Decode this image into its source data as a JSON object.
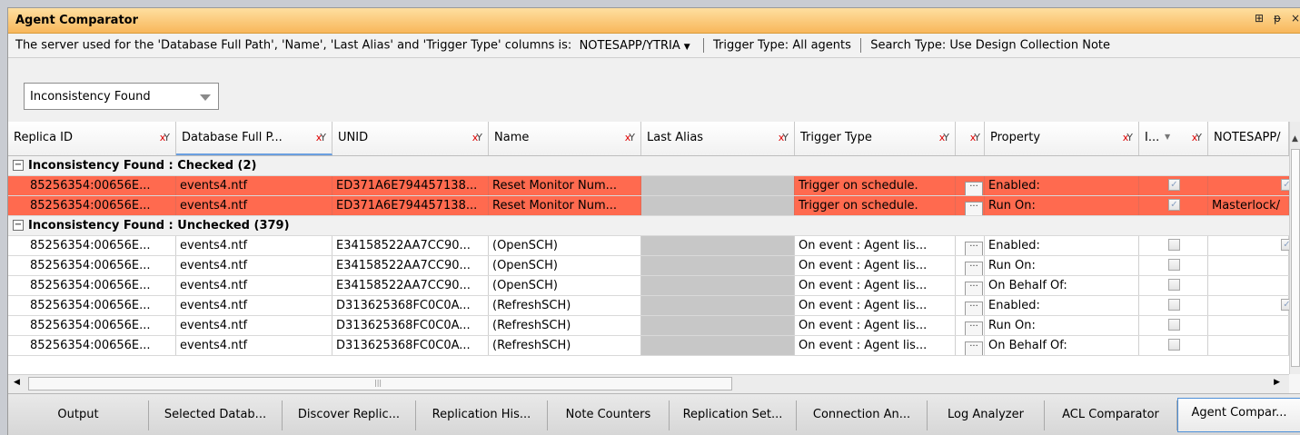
{
  "panel": {
    "title": "Agent Comparator",
    "controls": [
      "⊞",
      "ᵽ",
      "×"
    ]
  },
  "infobar": {
    "prefix": "The server used for the 'Database Full Path', 'Name', 'Last Alias' and 'Trigger Type' columns is:",
    "server": "NOTESAPP/YTRIA",
    "trigger": "Trigger Type:  All agents",
    "search": "Search Type:  Use Design Collection Note"
  },
  "filter": {
    "value": "Inconsistency Found"
  },
  "columns": [
    "Replica ID",
    "Database Full P...",
    "UNID",
    "Name",
    "Last Alias",
    "Trigger Type",
    "",
    "Property",
    "I...",
    "NOTESAPP/"
  ],
  "groups": [
    {
      "label": "Inconsistency Found : Checked (2)",
      "rows": [
        {
          "replica": "85256354:00656E...",
          "db": "events4.ntf",
          "unid": "ED371A6E794457138...",
          "name": "Reset Monitor Num...",
          "trigger": "Trigger on schedule.",
          "property": "Enabled:",
          "i_checked": true,
          "last_checked": true,
          "last_text": ""
        },
        {
          "replica": "85256354:00656E...",
          "db": "events4.ntf",
          "unid": "ED371A6E794457138...",
          "name": "Reset Monitor Num...",
          "trigger": "Trigger on schedule.",
          "property": "Run On:",
          "i_checked": true,
          "last_checked": false,
          "last_text": "Masterlock/"
        }
      ]
    },
    {
      "label": "Inconsistency Found : Unchecked (379)",
      "rows": [
        {
          "replica": "85256354:00656E...",
          "db": "events4.ntf",
          "unid": "E34158522AA7CC90...",
          "name": "(OpenSCH)",
          "trigger": "On event : Agent lis...",
          "property": "Enabled:",
          "i_checked": false,
          "last_checked": true,
          "last_text": ""
        },
        {
          "replica": "85256354:00656E...",
          "db": "events4.ntf",
          "unid": "E34158522AA7CC90...",
          "name": "(OpenSCH)",
          "trigger": "On event : Agent lis...",
          "property": "Run On:",
          "i_checked": false,
          "last_checked": false,
          "last_text": ""
        },
        {
          "replica": "85256354:00656E...",
          "db": "events4.ntf",
          "unid": "E34158522AA7CC90...",
          "name": "(OpenSCH)",
          "trigger": "On event : Agent lis...",
          "property": "On Behalf Of:",
          "i_checked": false,
          "last_checked": false,
          "last_text": ""
        },
        {
          "replica": "85256354:00656E...",
          "db": "events4.ntf",
          "unid": "D313625368FC0C0A...",
          "name": "(RefreshSCH)",
          "trigger": "On event : Agent lis...",
          "property": "Enabled:",
          "i_checked": false,
          "last_checked": true,
          "last_text": ""
        },
        {
          "replica": "85256354:00656E...",
          "db": "events4.ntf",
          "unid": "D313625368FC0C0A...",
          "name": "(RefreshSCH)",
          "trigger": "On event : Agent lis...",
          "property": "Run On:",
          "i_checked": false,
          "last_checked": false,
          "last_text": ""
        },
        {
          "replica": "85256354:00656E...",
          "db": "events4.ntf",
          "unid": "D313625368FC0C0A...",
          "name": "(RefreshSCH)",
          "trigger": "On event : Agent lis...",
          "property": "On Behalf Of:",
          "i_checked": false,
          "last_checked": false,
          "last_text": ""
        }
      ]
    }
  ],
  "ellipsis": "···",
  "tabs": [
    "Output",
    "Selected Datab...",
    "Discover Replic...",
    "Replication His...",
    "Note Counters",
    "Replication Set...",
    "Connection An...",
    "Log Analyzer",
    "ACL Comparator",
    "Agent Compar..."
  ],
  "active_tab": 9,
  "colors": {
    "selected_row": "#ff6a4f",
    "title_gradient": "#f8b75b"
  }
}
